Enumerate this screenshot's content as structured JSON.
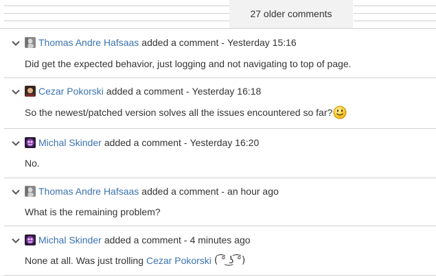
{
  "older_comments": {
    "label": "27 older comments"
  },
  "action_text": "added a comment",
  "separator": "-",
  "colors": {
    "link": "#3b73af",
    "text": "#333333",
    "divider": "#d0d0d0",
    "older_button_bg": "#f2f2f2"
  },
  "comments": [
    {
      "author": "Thomas Andre Hafsaas",
      "avatar_icon": "grey-person-avatar-icon",
      "time": "Yesterday 15:16",
      "body": "Did get the expected behavior, just logging and not navigating to top of page."
    },
    {
      "author": "Cezar Pokorski",
      "avatar_icon": "photo-avatar-icon",
      "time": "Yesterday 16:18",
      "body": "So the newest/patched version solves all the issues encountered so far?",
      "emoticon": "smile-emoticon-icon"
    },
    {
      "author": "Michal Skinder",
      "avatar_icon": "purple-avatar-icon",
      "time": "Yesterday 16:20",
      "body": "No."
    },
    {
      "author": "Thomas Andre Hafsaas",
      "avatar_icon": "grey-person-avatar-icon",
      "time": "an hour ago",
      "body": "What is the remaining problem?"
    },
    {
      "author": "Michal Skinder",
      "avatar_icon": "purple-avatar-icon",
      "time": "4 minutes ago",
      "body_prefix": "None at all. Was just trolling",
      "mention": "Cezar Pokorski",
      "body_suffix": "( ͡° ͜ʖ ͡°)"
    }
  ]
}
